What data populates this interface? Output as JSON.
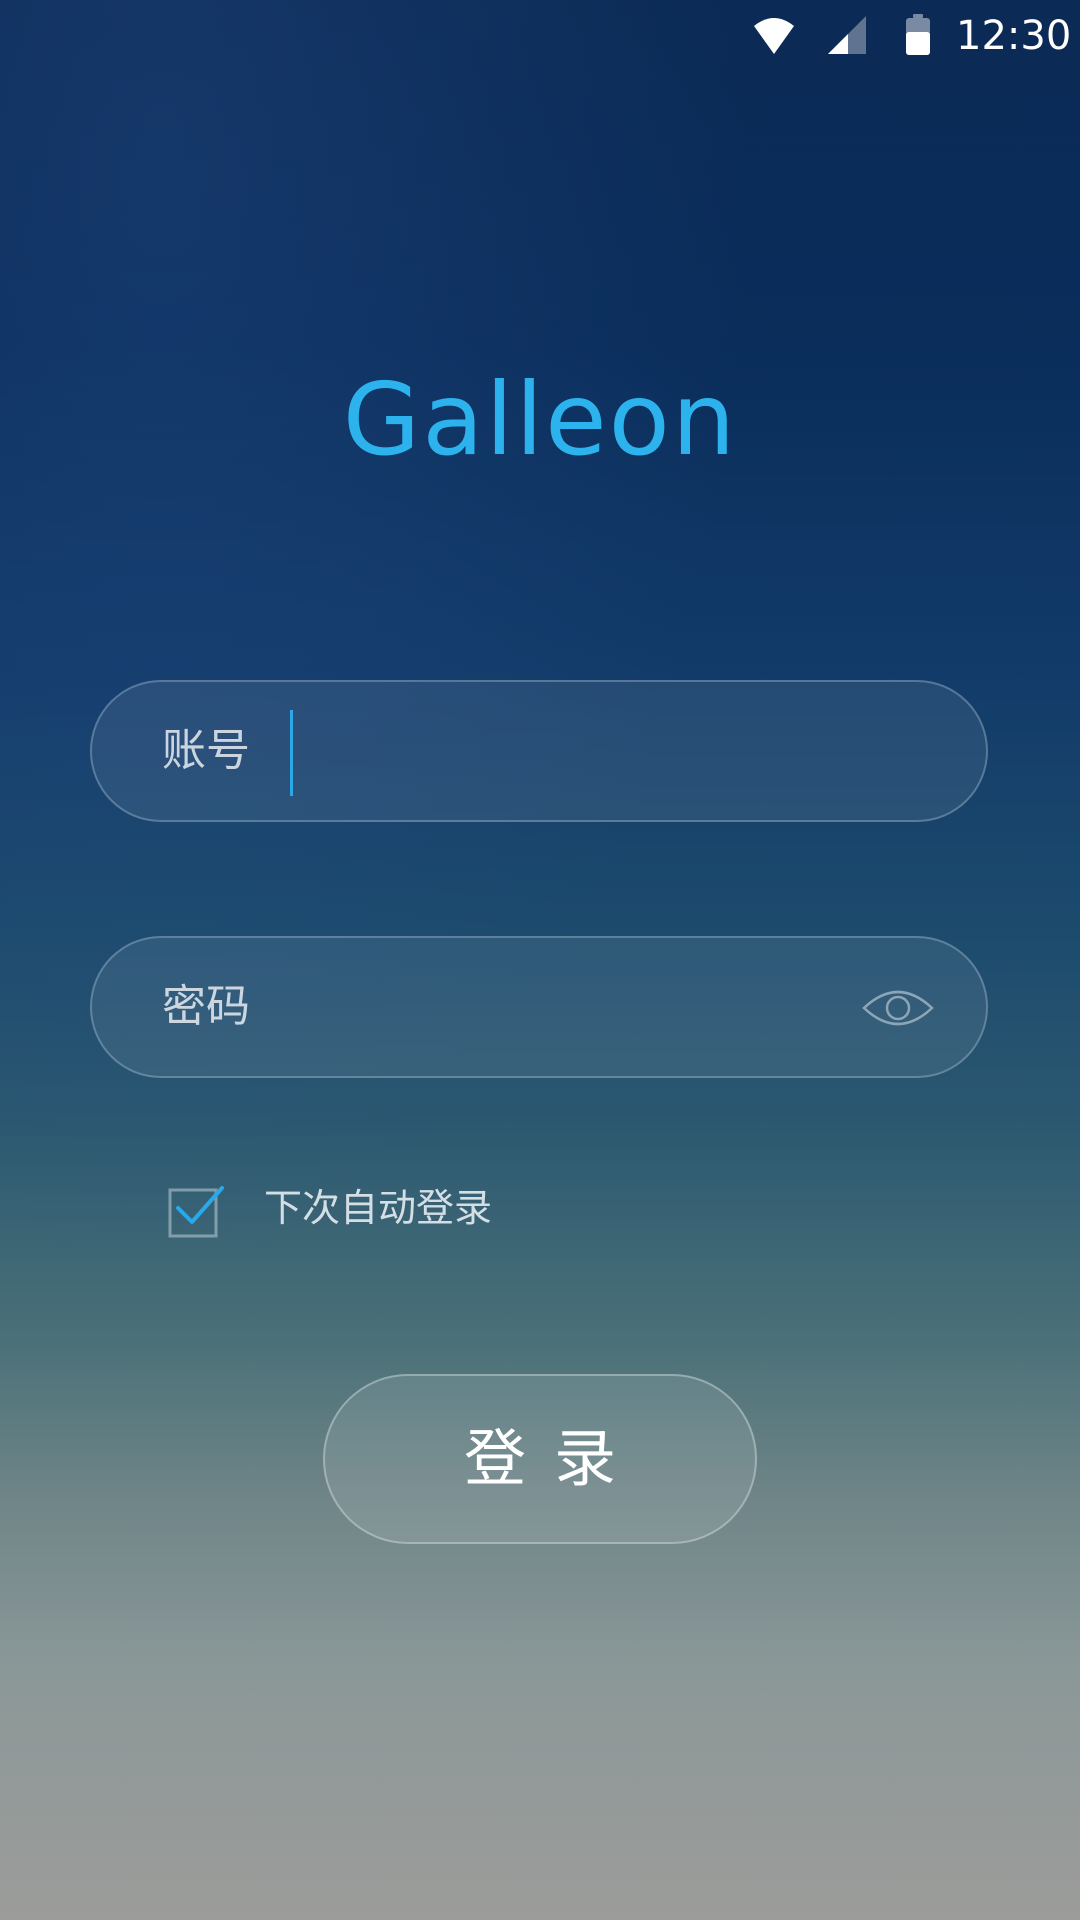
{
  "status_bar": {
    "time": "12:30",
    "icons": [
      "wifi-icon",
      "cellular-signal-icon",
      "battery-icon"
    ]
  },
  "app": {
    "title": "Galleon"
  },
  "account_field": {
    "label": "账号",
    "value": "",
    "focused": true
  },
  "password_field": {
    "label": "密码",
    "value": "",
    "toggle_icon": "eye-icon"
  },
  "remember": {
    "label": "下次自动登录",
    "checked": true
  },
  "login_button": {
    "label": "登录"
  },
  "colors": {
    "accent": "#2cb3ee",
    "cursor": "#2aa8e8",
    "text": "#ffffff"
  }
}
